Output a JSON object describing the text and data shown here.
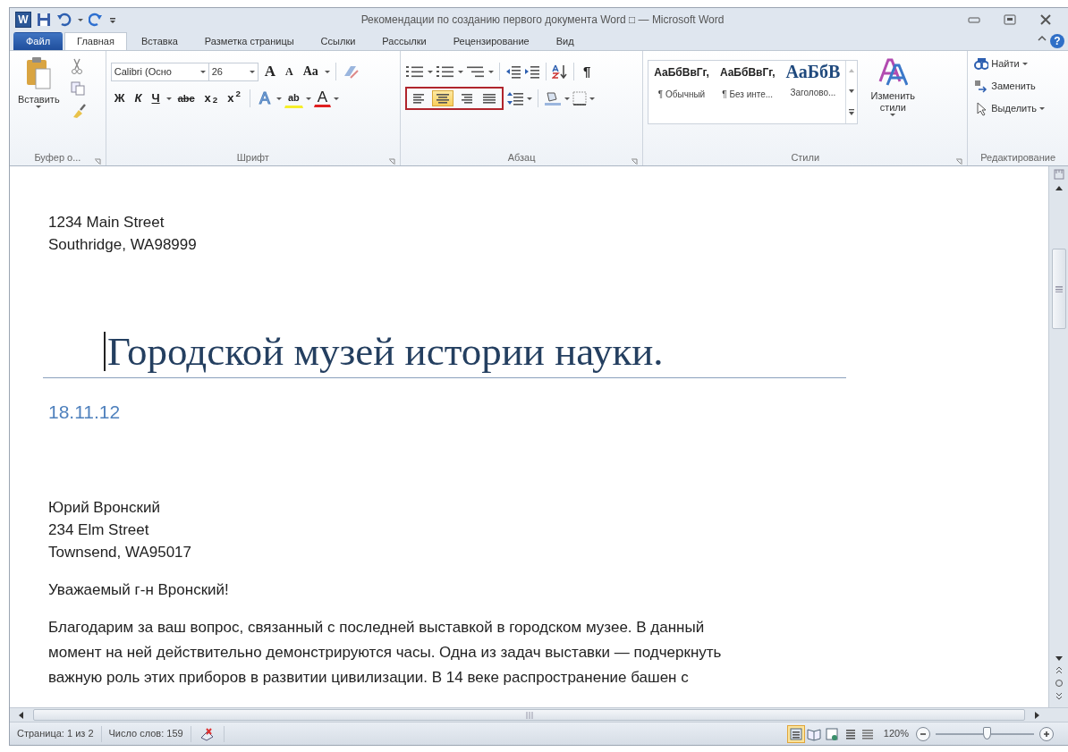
{
  "window": {
    "app_icon": "W",
    "title": "Рекомендации по созданию первого документа Word □ — Microsoft Word",
    "help": "?"
  },
  "tabs": [
    {
      "label": "Файл",
      "kind": "file",
      "selected": false
    },
    {
      "label": "Главная",
      "kind": "tab",
      "selected": true
    },
    {
      "label": "Вставка",
      "kind": "tab",
      "selected": false
    },
    {
      "label": "Разметка страницы",
      "kind": "tab",
      "selected": false
    },
    {
      "label": "Ссылки",
      "kind": "tab",
      "selected": false
    },
    {
      "label": "Рассылки",
      "kind": "tab",
      "selected": false
    },
    {
      "label": "Рецензирование",
      "kind": "tab",
      "selected": false
    },
    {
      "label": "Вид",
      "kind": "tab",
      "selected": false
    }
  ],
  "ribbon": {
    "clipboard": {
      "paste": "Вставить",
      "label": "Буфер о..."
    },
    "font": {
      "name": "Calibri (Осно",
      "size_text": "26",
      "row1": [
        {
          "text": "A",
          "kind": "grow"
        },
        {
          "text": "A",
          "kind": "shrink"
        },
        {
          "text": "Aa",
          "kind": "case"
        }
      ],
      "row2": [
        {
          "text": "Ж",
          "kind": "bold"
        },
        {
          "text": "К",
          "kind": "italic"
        },
        {
          "text": "Ч",
          "kind": "underline"
        },
        {
          "text": "abc",
          "kind": "strike"
        },
        {
          "text": "x$_{2}$",
          "kind": "sub"
        },
        {
          "text": "x$^{2}$",
          "kind": "sup"
        },
        {
          "text": "A",
          "kind": "effects"
        },
        {
          "text": "ab",
          "kind": "highlight"
        },
        {
          "text": "A",
          "kind": "color"
        }
      ],
      "label": "Шрифт"
    },
    "paragraph": {
      "align": [
        {
          "kind": "left",
          "selected": false
        },
        {
          "kind": "center",
          "selected": true
        },
        {
          "kind": "right",
          "selected": false
        },
        {
          "kind": "justify",
          "selected": false
        }
      ],
      "align_marked": true,
      "pilcrow": "¶",
      "label": "Абзац"
    },
    "styles": {
      "items": [
        {
          "sample": "АаБбВвГг,",
          "name": "¶ Обычный",
          "kind": "body"
        },
        {
          "sample": "АаБбВвГг,",
          "name": "¶ Без инте...",
          "kind": "body"
        },
        {
          "sample": "АаБбВ",
          "name": "Заголово...",
          "kind": "heading"
        }
      ],
      "change": "Изменить стили",
      "label": "Стили"
    },
    "editing": {
      "items": [
        {
          "label": "Найти",
          "kind": "find",
          "dropdown": true
        },
        {
          "label": "Заменить",
          "kind": "replace",
          "dropdown": false
        },
        {
          "label": "Выделить",
          "kind": "select",
          "dropdown": true
        }
      ],
      "label": "Редактирование"
    }
  },
  "document": {
    "sender": [
      "1234 Main Street",
      "Southridge, WA98999"
    ],
    "title": "Городской музей истории науки.",
    "date": "18.11.12",
    "recipient": [
      "Юрий Вронский",
      "234 Elm Street",
      "Townsend, WA95017"
    ],
    "greeting": "Уважаемый г-н Вронский!",
    "body": [
      "Благодарим за ваш вопрос, связанный с последней выставкой в городском музее. В данный",
      "момент на ней действительно демонстрируются часы. Одна из задач выставки — подчеркнуть",
      "важную роль этих приборов в развитии цивилизации. В 14 веке распространение башен с"
    ]
  },
  "status_bar": {
    "page": "Страница: 1 из 2",
    "words": "Число слов: 159",
    "views": [
      {
        "kind": "print",
        "selected": true
      },
      {
        "kind": "reading",
        "selected": false
      },
      {
        "kind": "web",
        "selected": false
      },
      {
        "kind": "outline",
        "selected": false
      },
      {
        "kind": "draft",
        "selected": false
      }
    ],
    "zoom": "120%",
    "zoom_slider": {
      "level": 0.52
    }
  }
}
